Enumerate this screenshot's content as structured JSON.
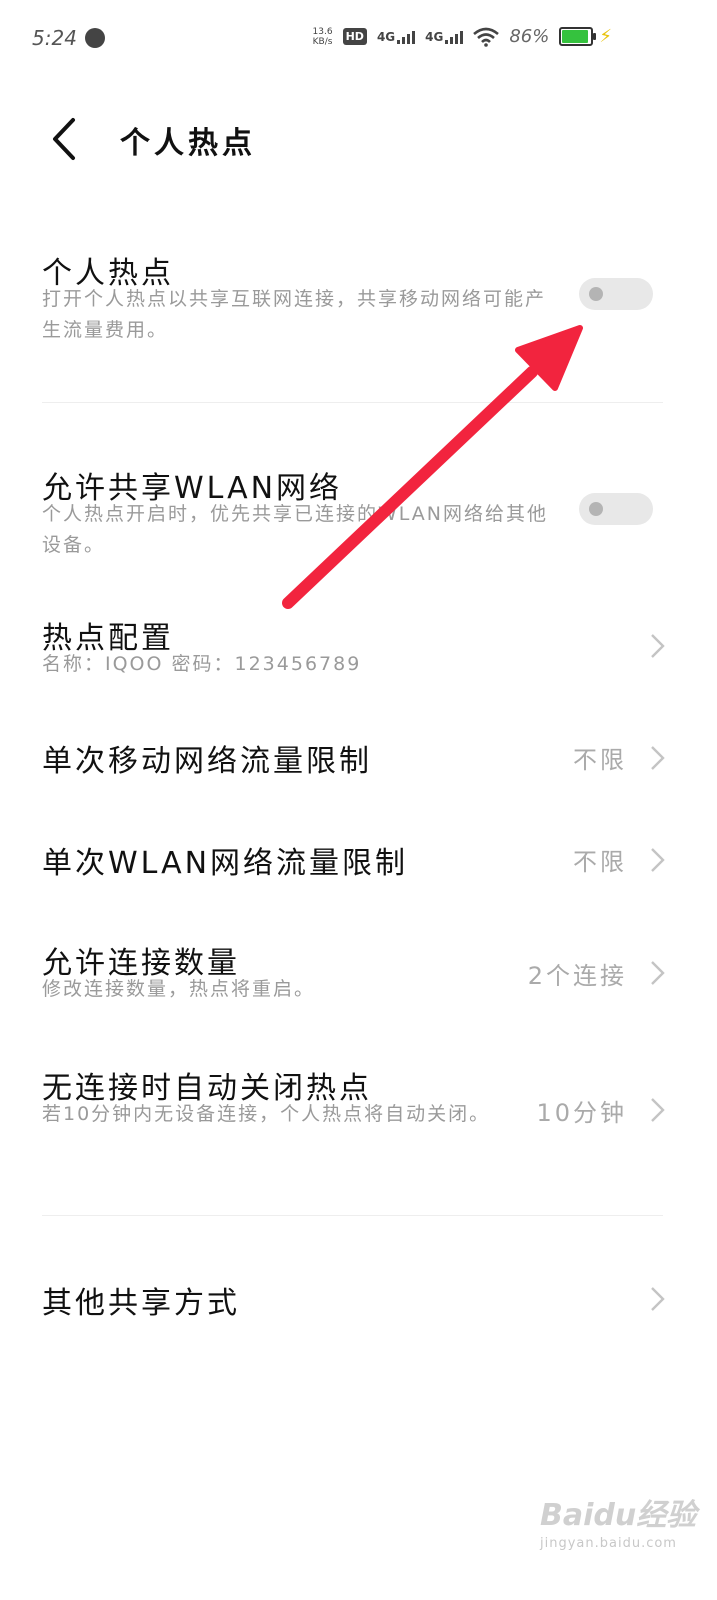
{
  "status_bar": {
    "time": "5:24",
    "net_speed_value": "13.6",
    "net_speed_unit": "KB/s",
    "hd": "HD",
    "sim1": "4G",
    "sim2": "4G",
    "battery_percent": "86%"
  },
  "header": {
    "title": "个人热点"
  },
  "rows": {
    "hotspot": {
      "title": "个人热点",
      "subtitle": "打开个人热点以共享互联网连接，共享移动网络可能产生流量费用。",
      "toggle_on": false
    },
    "share_wlan": {
      "title": "允许共享WLAN网络",
      "subtitle": "个人热点开启时，优先共享已连接的WLAN网络给其他设备。",
      "toggle_on": false
    },
    "config": {
      "title": "热点配置",
      "subtitle": "名称：IQOO 密码：123456789"
    },
    "mobile_limit": {
      "title": "单次移动网络流量限制",
      "value": "不限"
    },
    "wlan_limit": {
      "title": "单次WLAN网络流量限制",
      "value": "不限"
    },
    "connections": {
      "title": "允许连接数量",
      "subtitle": "修改连接数量，热点将重启。",
      "value": "2个连接"
    },
    "auto_close": {
      "title": "无连接时自动关闭热点",
      "subtitle": "若10分钟内无设备连接，个人热点将自动关闭。",
      "value": "10分钟"
    },
    "other_share": {
      "title": "其他共享方式"
    }
  },
  "watermark": {
    "logo": "Baidu经验",
    "url": "jingyan.baidu.com"
  },
  "colors": {
    "annotation_arrow": "#f2243e",
    "battery": "#35c23e"
  }
}
